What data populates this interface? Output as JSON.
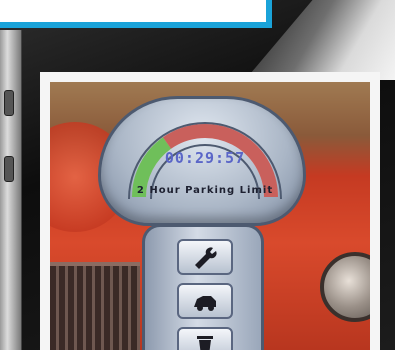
{
  "meter": {
    "timer": "00:29:57",
    "limit_label": "2 Hour Parking Limit"
  },
  "icons": {
    "settings": "wrench-icon",
    "car": "car-icon",
    "trash": "trash-icon"
  },
  "colors": {
    "accent": "#1aa3d9",
    "timer_text": "#5a66c8",
    "gauge_green": "#6fbf5a",
    "gauge_red": "#c9605c"
  }
}
